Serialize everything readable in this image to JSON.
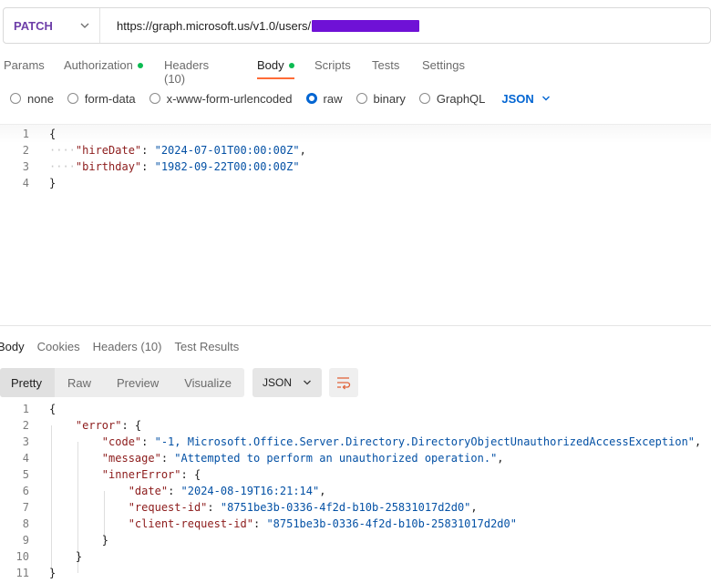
{
  "request": {
    "method": "PATCH",
    "url": "https://graph.microsoft.us/v1.0/users/"
  },
  "request_tabs": [
    {
      "label": "Params",
      "dot": false
    },
    {
      "label": "Authorization",
      "dot": true
    },
    {
      "label": "Headers (10)",
      "dot": false
    },
    {
      "label": "Body",
      "dot": true
    },
    {
      "label": "Scripts",
      "dot": false
    },
    {
      "label": "Tests",
      "dot": false
    },
    {
      "label": "Settings",
      "dot": false
    }
  ],
  "body_types": [
    {
      "label": "none",
      "checked": false
    },
    {
      "label": "form-data",
      "checked": false
    },
    {
      "label": "x-www-form-urlencoded",
      "checked": false
    },
    {
      "label": "raw",
      "checked": true
    },
    {
      "label": "binary",
      "checked": false
    },
    {
      "label": "GraphQL",
      "checked": false
    }
  ],
  "raw_format": "JSON",
  "request_body_lines": [
    {
      "n": "1",
      "indent": 0,
      "parts": [
        [
          "p",
          "{"
        ]
      ]
    },
    {
      "n": "2",
      "indent": 1,
      "parts": [
        [
          "k",
          "\"hireDate\""
        ],
        [
          "p",
          ": "
        ],
        [
          "s",
          "\"2024-07-01T00:00:00Z\""
        ],
        [
          "p",
          ","
        ]
      ]
    },
    {
      "n": "3",
      "indent": 1,
      "parts": [
        [
          "k",
          "\"birthday\""
        ],
        [
          "p",
          ": "
        ],
        [
          "s",
          "\"1982-09-22T00:00:00Z\""
        ]
      ]
    },
    {
      "n": "4",
      "indent": 0,
      "parts": [
        [
          "p",
          "}"
        ]
      ]
    }
  ],
  "response_tabs": [
    {
      "label": "Body"
    },
    {
      "label": "Cookies"
    },
    {
      "label": "Headers (10)"
    },
    {
      "label": "Test Results"
    }
  ],
  "view_modes": [
    "Pretty",
    "Raw",
    "Preview",
    "Visualize"
  ],
  "response_format": "JSON",
  "response_lines": [
    {
      "n": "1",
      "indent": 0,
      "parts": [
        [
          "p",
          "{"
        ]
      ]
    },
    {
      "n": "2",
      "indent": 1,
      "parts": [
        [
          "k",
          "\"error\""
        ],
        [
          "p",
          ": {"
        ]
      ]
    },
    {
      "n": "3",
      "indent": 2,
      "parts": [
        [
          "k",
          "\"code\""
        ],
        [
          "p",
          ": "
        ],
        [
          "s",
          "\"-1, Microsoft.Office.Server.Directory.DirectoryObjectUnauthorizedAccessException\""
        ],
        [
          "p",
          ","
        ]
      ]
    },
    {
      "n": "4",
      "indent": 2,
      "parts": [
        [
          "k",
          "\"message\""
        ],
        [
          "p",
          ": "
        ],
        [
          "s",
          "\"Attempted to perform an unauthorized operation.\""
        ],
        [
          "p",
          ","
        ]
      ]
    },
    {
      "n": "5",
      "indent": 2,
      "parts": [
        [
          "k",
          "\"innerError\""
        ],
        [
          "p",
          ": {"
        ]
      ]
    },
    {
      "n": "6",
      "indent": 3,
      "parts": [
        [
          "k",
          "\"date\""
        ],
        [
          "p",
          ": "
        ],
        [
          "s",
          "\"2024-08-19T16:21:14\""
        ],
        [
          "p",
          ","
        ]
      ]
    },
    {
      "n": "7",
      "indent": 3,
      "parts": [
        [
          "k",
          "\"request-id\""
        ],
        [
          "p",
          ": "
        ],
        [
          "s",
          "\"8751be3b-0336-4f2d-b10b-25831017d2d0\""
        ],
        [
          "p",
          ","
        ]
      ]
    },
    {
      "n": "8",
      "indent": 3,
      "parts": [
        [
          "k",
          "\"client-request-id\""
        ],
        [
          "p",
          ": "
        ],
        [
          "s",
          "\"8751be3b-0336-4f2d-b10b-25831017d2d0\""
        ]
      ]
    },
    {
      "n": "9",
      "indent": 2,
      "parts": [
        [
          "p",
          "}"
        ]
      ]
    },
    {
      "n": "10",
      "indent": 1,
      "parts": [
        [
          "p",
          "}"
        ]
      ]
    },
    {
      "n": "11",
      "indent": 0,
      "parts": [
        [
          "p",
          "}"
        ]
      ]
    }
  ],
  "colors": {
    "method": "#6d3ea8",
    "active_tab_underline": "#ff6c37",
    "status_dot": "#0cbb52",
    "accent_blue": "#0265d2",
    "json_key": "#8c1b1b",
    "json_string": "#0451a5",
    "redaction": "#6f11d6"
  }
}
